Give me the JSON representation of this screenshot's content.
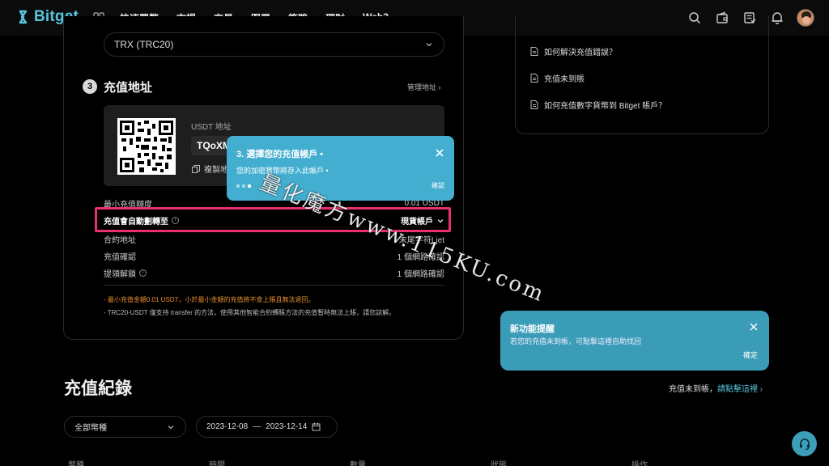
{
  "header": {
    "logo": "Bitget",
    "nav": [
      "快速買幣",
      "市場",
      "交易",
      "跟單",
      "策略",
      "理財",
      "Web3"
    ],
    "icons": [
      "search-icon",
      "wallet-icon",
      "orders-icon",
      "bell-icon",
      "avatar"
    ]
  },
  "deposit": {
    "network_value": "TRX (TRC20)",
    "step_number": "3",
    "step_title": "充值地址",
    "manage_link": "管理地址 ›",
    "address_label": "USDT 地址",
    "address_value": "TQoXM",
    "copy_label": "複製地",
    "rows": {
      "min_label": "最小充值額度",
      "min_value": "0.01 USDT",
      "auto_transfer_label": "充值會自動劃轉至",
      "auto_transfer_value": "現貨帳戶",
      "contract_label": "合約地址",
      "contract_value": "末尾字符Ljet",
      "confirm_label": "充值確認",
      "confirm_value": "1 個網路確認",
      "unlock_label": "提領解鎖",
      "unlock_value": "1 個網路確認"
    },
    "note_warning": "- 最小充值金額0.01 USDT，小於最小金額的充值將不會上賬且無法退回。",
    "note_info": "- TRC20-USDT 僅支持 transfer 的方法，使用其他智能合約轉賬方法的充值暫時無法上賬，請您諒解。"
  },
  "faq": [
    "如何解決充值錯誤？",
    "充值未到賬",
    "如何充值數字貨幣到 Bitget 賬戶？"
  ],
  "tour": {
    "title": "3. 選擇您的充值帳戶 •",
    "description": "您的加密貨幣將存入此帳戶 •",
    "confirm": "確認"
  },
  "notification": {
    "title": "新功能提醒",
    "description": "若您的充值未到帳，可點擊這裡自助找回",
    "confirm": "確定"
  },
  "watermark": "量化魔方www.115KU.com",
  "records": {
    "title": "充值紀錄",
    "not_received_text": "充值未到帳，",
    "not_received_link": "請點擊這裡 ›",
    "coin_filter": "全部幣種",
    "date_start": "2023-12-08",
    "date_sep": "—",
    "date_end": "2023-12-14",
    "columns": [
      "幣種",
      "時間",
      "數量",
      "狀態",
      "操作"
    ]
  }
}
